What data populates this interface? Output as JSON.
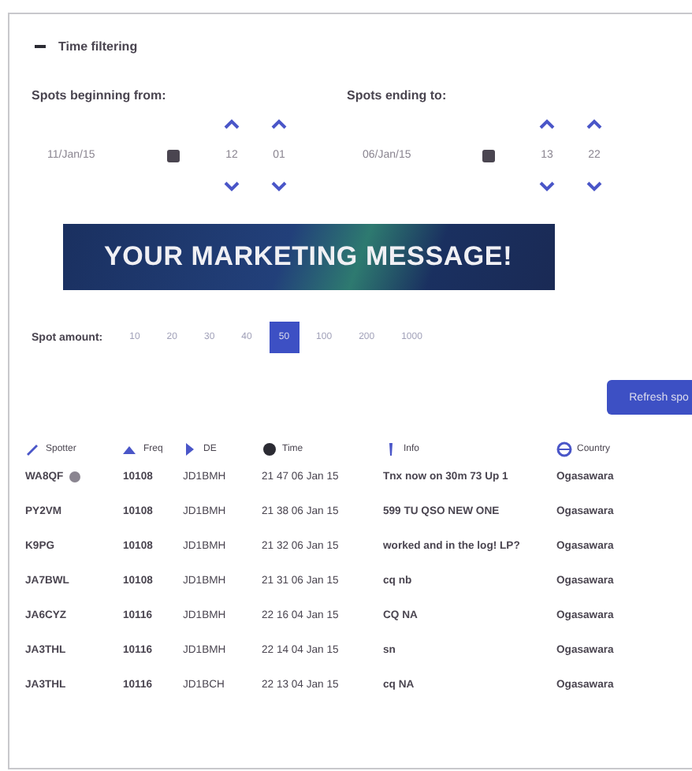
{
  "panel": {
    "title": "Time filtering",
    "expanded": true
  },
  "from": {
    "label": "Spots beginning from:",
    "date": "11/Jan/15",
    "hour": "12",
    "minute": "01"
  },
  "to": {
    "label": "Spots ending to:",
    "date": "06/Jan/15",
    "hour": "13",
    "minute": "22"
  },
  "banner": {
    "text": "YOUR MARKETING MESSAGE!"
  },
  "spot_amount": {
    "label": "Spot amount:",
    "options": [
      {
        "label": "10",
        "selected": false
      },
      {
        "label": "20",
        "selected": false
      },
      {
        "label": "30",
        "selected": false
      },
      {
        "label": "40",
        "selected": false
      },
      {
        "label": "50",
        "selected": true
      },
      {
        "label": "100",
        "selected": false
      },
      {
        "label": "200",
        "selected": false
      },
      {
        "label": "1000",
        "selected": false
      }
    ]
  },
  "refresh_button": "Refresh spo",
  "table": {
    "columns": [
      "Spotter",
      "Freq",
      "DE",
      "Time",
      "Info",
      "Country"
    ],
    "rows": [
      {
        "cells": [
          "WA8QF",
          "10108",
          "JD1BMH",
          "21 47 06 Jan 15",
          "Tnx now on 30m  73 Up 1",
          "Ogasawara"
        ],
        "marked": true
      },
      {
        "cells": [
          "PY2VM",
          "10108",
          "JD1BMH",
          "21 38 06 Jan 15",
          "599 TU QSO  NEW ONE",
          "Ogasawara"
        ],
        "marked": false
      },
      {
        "cells": [
          "K9PG",
          "10108",
          "JD1BMH",
          "21 32 06 Jan 15",
          "worked and in the log! LP?",
          "Ogasawara"
        ],
        "marked": false
      },
      {
        "cells": [
          "JA7BWL",
          "10108",
          "JD1BMH",
          "21 31 06 Jan 15",
          "cq nb",
          "Ogasawara"
        ],
        "marked": false
      },
      {
        "cells": [
          "JA6CYZ",
          "10116",
          "JD1BMH",
          "22 16 04 Jan 15",
          "CQ NA",
          "Ogasawara"
        ],
        "marked": false
      },
      {
        "cells": [
          "JA3THL",
          "10116",
          "JD1BMH",
          "22 14 04 Jan 15",
          "sn",
          "Ogasawara"
        ],
        "marked": false
      },
      {
        "cells": [
          "JA3THL",
          "10116",
          "JD1BCH",
          "22 13 04 Jan 15",
          "cq NA",
          "Ogasawara"
        ],
        "marked": false
      }
    ]
  }
}
